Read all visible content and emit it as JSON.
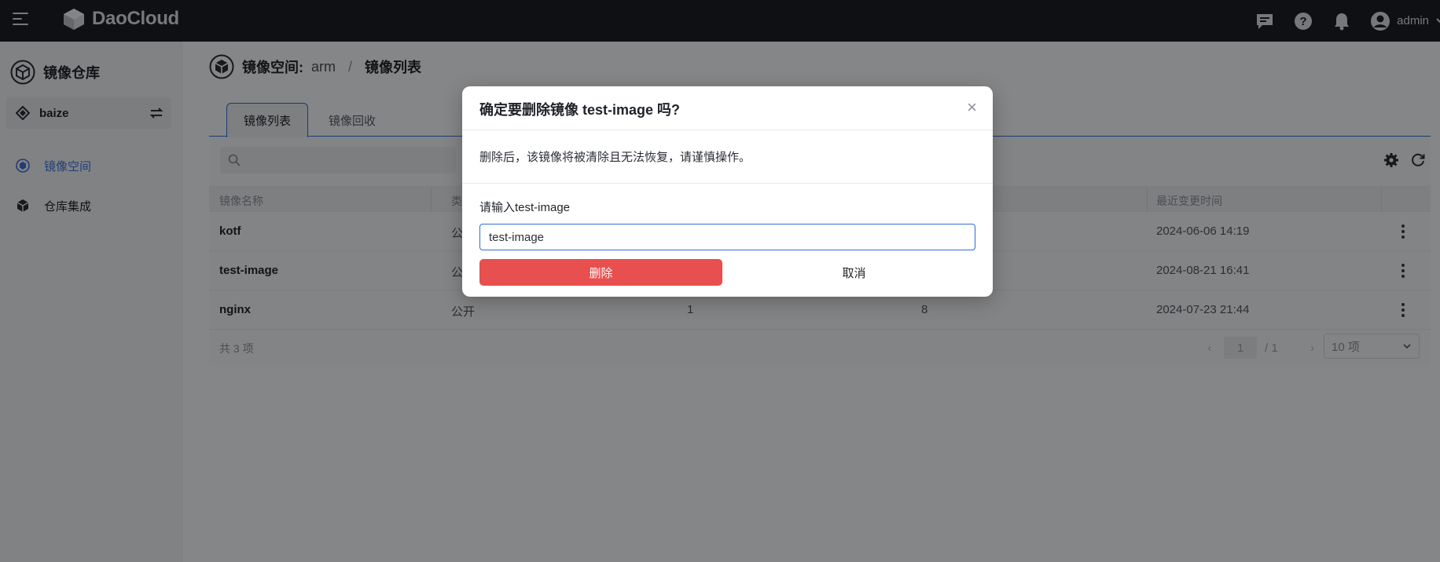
{
  "topbar": {
    "logo_text": "DaoCloud",
    "username": "admin",
    "icons": [
      "menu-icon",
      "chat-icon",
      "help-icon",
      "bell-icon",
      "user-avatar-icon",
      "chevron-down-icon"
    ]
  },
  "sidebar": {
    "title": "镜像仓库",
    "workspace": "baize",
    "items": [
      {
        "label": "镜像空间",
        "icon": "hexagon-icon",
        "active": true
      },
      {
        "label": "仓库集成",
        "icon": "cube-icon",
        "active": false
      }
    ]
  },
  "breadcrumb": {
    "label": "镜像空间:",
    "value": "arm",
    "separator": "/",
    "current": "镜像列表"
  },
  "tabs": [
    {
      "label": "镜像列表",
      "active": true
    },
    {
      "label": "镜像回收",
      "active": false
    }
  ],
  "table": {
    "headers": {
      "name": "镜像名称",
      "type": "类",
      "updated": "最近变更时间"
    },
    "rows": [
      {
        "name": "kotf",
        "type": "公",
        "col3": "",
        "col4": "",
        "updated": "2024-06-06 14:19"
      },
      {
        "name": "test-image",
        "type": "公",
        "col3": "",
        "col4": "",
        "updated": "2024-08-21 16:41"
      },
      {
        "name": "nginx",
        "type": "公开",
        "col3": "1",
        "col4": "8",
        "updated": "2024-07-23 21:44"
      }
    ],
    "total": "共 3 项",
    "page": "1",
    "page_total": "/ 1",
    "page_size": "10 项"
  },
  "modal": {
    "title": "确定要删除镜像 test-image 吗?",
    "description": "删除后，该镜像将被清除且无法恢复，请谨慎操作。",
    "input_label": "请输入test-image",
    "input_value": "test-image",
    "confirm_label": "删除",
    "cancel_label": "取消",
    "close_glyph": "×"
  },
  "colors": {
    "topbar": "#1c1e24",
    "accent": "#2f6bd9",
    "danger": "#e84f4f"
  }
}
